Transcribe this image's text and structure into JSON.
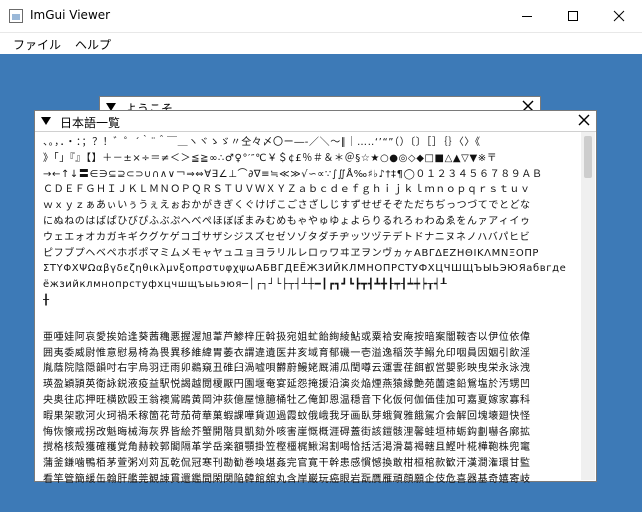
{
  "window": {
    "title": "ImGui Viewer",
    "controls": [
      "minimize-icon",
      "maximize-icon",
      "close-icon"
    ]
  },
  "menu": [
    "ファイル",
    "ヘルプ"
  ],
  "panels": {
    "welcome": {
      "title": "ようこそ",
      "close_icon": "close-icon"
    },
    "japanese": {
      "title": "日本語一覧",
      "close_icon": "close-icon",
      "lines": [
        "、。，．・：；？！゛゜´｀¨＾￣＿ヽヾゝゞ〃仝々〆〇ー―‐／＼～∥｜…‥‘’“”（）〔〕［］｛｝〈〉《",
        "》「」『』【】＋－±×÷＝≠＜＞≦≧∞∴♂♀°′″℃￥＄¢£％＃＆＊＠§☆★○●◎◇◆□■△▲▽▼※〒",
        "→←↑↓〓∈∋⊆⊇⊂⊃∪∩∧∨￢⇒⇔∀∃∠⊥⌒∂∇≡≒≪≫√∽∝∵∫∬Å‰♯♭♪†‡¶◯０１２３４５６７８９ＡＢ",
        "ＣＤＥＦＧＨＩＪＫＬＭＮＯＰＱＲＳＴＵＶＷＸＹＺａｂｃｄｅｆｇｈｉｊｋｌｍｎｏｐｑｒｓｔｕｖ",
        "ｗｘｙｚぁあぃいぅうぇえぉおかがきぎくぐけげこごさざしじすずせぜそぞただちぢっつづてでとどな",
        "にぬねのはばぱひびぴふぶぷへべぺほぼぽまみむめもゃやゅゆょよらりるれろゎわゐゑをんァアィイゥ",
        "ウェエォオカガキギクグケゲコゴサザシジスズセゼソゾタダチヂッツヅテデトドナニヌネノハバパヒビ",
        "ピフブプヘベペホボポマミムメモャヤュユョヨラリルレロヮワヰヱヲンヴヵヶΑΒΓΔΕΖΗΘΙΚΛΜΝΞΟΠΡ",
        "ΣΤΥΦΧΨΩαβγδεζηθικλμνξοπρστυφχψωАБВГДЕЁЖЗИЙКЛМНОПРСТУФХЦЧШЩЪЫЬЭЮЯабвгде",
        "ёжзийклмнопрстуфхцчшщъыьэюя─│┌┐┘└├┬┤┴┼━┃┏┓┛┗┣┳┫┻╋┠┯┨┷┿┝┰┥┸",
        "╂",
        "亜唖娃阿哀愛挨姶逢葵茜穐悪握渥旭葦芦鯵梓圧斡扱宛姐虻飴絢綾鮎或粟袷安庵按暗案闇鞍杏以伊位依偉",
        "囲夷委威尉惟意慰易椅為畏異移維緯胃萎衣謂違遺医井亥域育郁磯一壱溢逸稲茨芋鰯允印咽員因姻引飲淫",
        "胤蔭院陰隠韻吋右宇烏羽迂雨卯鵜窺丑碓臼渦嘘唄欝蔚鰻姥厩浦瓜閏噂云運雲荏餌叡営嬰影映曳栄永泳洩",
        "瑛盈穎頴英衛詠鋭液疫益駅悦謁越閲榎厭円園堰奄宴延怨掩援沿演炎焔煙燕猿縁艶苑薗遠鉛鴛塩於汚甥凹",
        "央奥往応押旺横欧殴王翁襖鴬鴎黄岡沖荻億屋憶臆桶牡乙俺卸恩温穏音下化仮何伽価佳加可嘉夏嫁家寡科",
        "暇果架歌河火珂禍禾稼箇花苛茄荷華菓蝦課嘩貨迦過霞蚊俄峨我牙画臥芽蛾賀雅餓駕介会解回塊壊廻快怪",
        "悔恢懐戒拐改魁晦械海灰界皆絵芥蟹開階貝凱劾外咳害崖慨概涯碍蓋街該鎧骸浬馨蛙垣柿蛎鈎劃嚇各廓拡",
        "撹格核殻獲確穫覚角赫較郭閣隔革学岳楽額顎掛笠樫橿梶鰍潟割喝恰括活渇滑葛褐轄且鰹叶椛樺鞄株兜竃",
        "蒲釜鎌噛鴨栢茅萱粥刈苅瓦乾侃冠寒刊勘勧巻喚堪姦完官寛干幹患感慣憾換敢柑桓棺款歓汗漢澗潅環甘監",
        "看竿管簡緩缶翰肝艦莞観諌貫還鑑間閑関陥韓館舘丸含岸巌玩癌眼岩翫贋雁頑顔願企伎危喜器基奇嬉寄岐"
      ]
    }
  }
}
